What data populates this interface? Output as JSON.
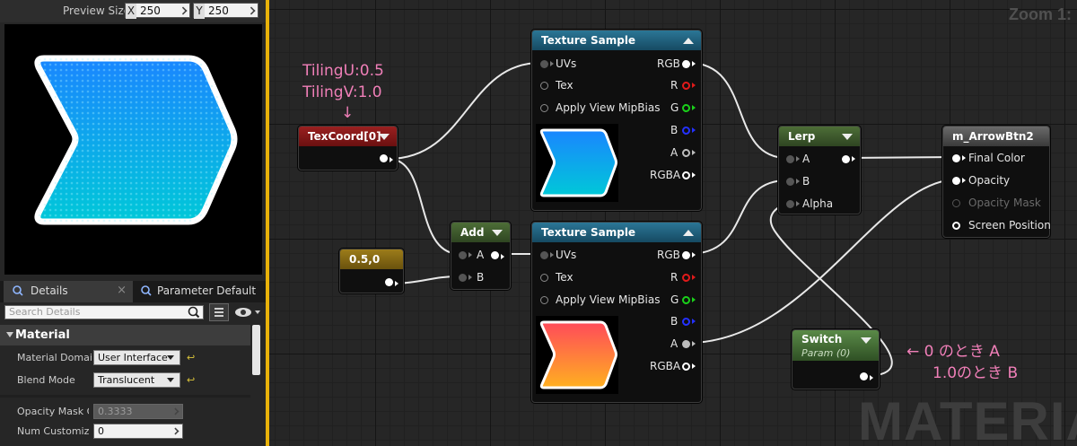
{
  "preview": {
    "size_label": "Preview Size",
    "x_axis": "X",
    "x_value": "250",
    "y_axis": "Y",
    "y_value": "250"
  },
  "tabs": [
    {
      "label": "Details",
      "close": "×"
    },
    {
      "label": "Parameter Default"
    }
  ],
  "search": {
    "placeholder": "Search Details"
  },
  "details": {
    "category": "Material",
    "material_domain_label": "Material Domain",
    "material_domain_value": "User Interface",
    "blend_mode_label": "Blend Mode",
    "blend_mode_value": "Translucent",
    "opacity_mask_label": "Opacity Mask Cl",
    "opacity_mask_value": "0.3333",
    "num_customized_label": "Num Customized",
    "num_customized_value": "0",
    "reset_glyph": "↩"
  },
  "graph": {
    "zoom": "Zoom 1:",
    "watermark": "MATERIAL"
  },
  "nodes": {
    "texcoord": {
      "title": "TexCoord[0]"
    },
    "const": {
      "title": "0.5,0"
    },
    "add": {
      "title": "Add",
      "a": "A",
      "b": "B"
    },
    "tex1": {
      "title": "Texture Sample",
      "uvs": "UVs",
      "tex": "Tex",
      "mip": "Apply View MipBias",
      "rgb": "RGB",
      "r": "R",
      "g": "G",
      "b": "B",
      "a": "A",
      "rgba": "RGBA"
    },
    "tex2": {
      "title": "Texture Sample",
      "uvs": "UVs",
      "tex": "Tex",
      "mip": "Apply View MipBias",
      "rgb": "RGB",
      "r": "R",
      "g": "G",
      "b": "B",
      "a": "A",
      "rgba": "RGBA"
    },
    "lerp": {
      "title": "Lerp",
      "a": "A",
      "b": "B",
      "alpha": "Alpha"
    },
    "switch": {
      "title": "Switch",
      "subtitle": "Param (0)"
    },
    "result": {
      "title": "m_ArrowBtn2",
      "final_color": "Final Color",
      "opacity": "Opacity",
      "opacity_mask": "Opacity Mask",
      "screen_position": "Screen Position"
    }
  },
  "annotations": {
    "tiling_u": "TilingU:0.5",
    "tiling_v": "TilingV:1.0",
    "down_arrow": "↓",
    "switch_line1": "← 0 のとき A",
    "switch_line2": "1.0のとき B"
  },
  "colors": {
    "texcoord_header": "#8a1818",
    "const_header": "#8a6a14",
    "add_header": "#3e5a2c",
    "texture_header": "#1f5f7a",
    "lerp_header": "#3e5a2c",
    "switch_header": "#46703a",
    "result_header": "#4a4a4a",
    "annotation": "#f07fb8",
    "graph_border": "#e9b20a"
  }
}
